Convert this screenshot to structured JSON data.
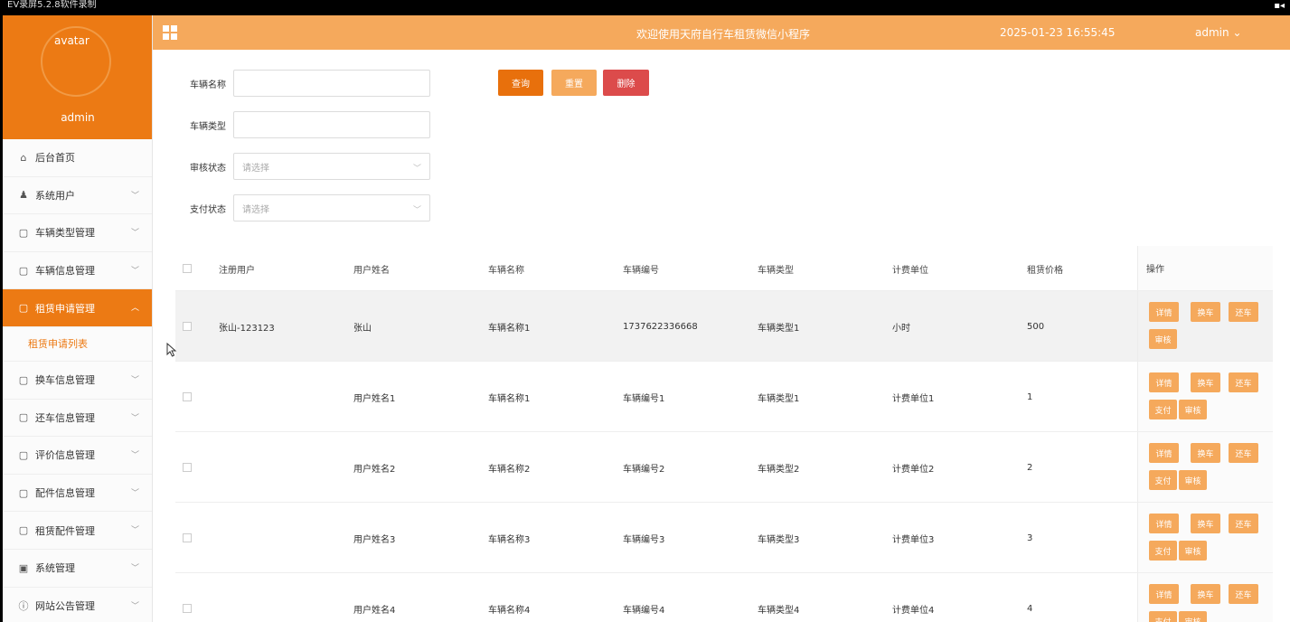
{
  "recorder": {
    "title": "EV录屏5.2.8软件录制"
  },
  "sidebar": {
    "avatar_text": "avatar",
    "username": "admin",
    "items": [
      {
        "label": "后台首页",
        "icon": "home-icon",
        "has_chevron": false
      },
      {
        "label": "系统用户",
        "icon": "user-icon",
        "has_chevron": true
      },
      {
        "label": "车辆类型管理",
        "icon": "doc-icon",
        "has_chevron": true
      },
      {
        "label": "车辆信息管理",
        "icon": "doc-icon",
        "has_chevron": true
      },
      {
        "label": "租赁申请管理",
        "icon": "doc-icon",
        "has_chevron": true,
        "active": true
      },
      {
        "label": "换车信息管理",
        "icon": "doc-icon",
        "has_chevron": true
      },
      {
        "label": "还车信息管理",
        "icon": "doc-icon",
        "has_chevron": true
      },
      {
        "label": "评价信息管理",
        "icon": "doc-icon",
        "has_chevron": true
      },
      {
        "label": "配件信息管理",
        "icon": "doc-icon",
        "has_chevron": true
      },
      {
        "label": "租赁配件管理",
        "icon": "doc-icon",
        "has_chevron": true
      },
      {
        "label": "系统管理",
        "icon": "image-icon",
        "has_chevron": true
      },
      {
        "label": "网站公告管理",
        "icon": "info-icon",
        "has_chevron": true
      }
    ],
    "submenu": {
      "label": "租赁申请列表"
    }
  },
  "header": {
    "title": "欢迎使用天府自行车租赁微信小程序",
    "datetime": "2025-01-23 16:55:45",
    "user": "admin"
  },
  "filters": {
    "vehicle_name_label": "车辆名称",
    "vehicle_type_label": "车辆类型",
    "audit_status_label": "审核状态",
    "audit_status_placeholder": "请选择",
    "pay_status_label": "支付状态",
    "pay_status_placeholder": "请选择"
  },
  "buttons": {
    "search": "查询",
    "reset": "重置",
    "delete": "删除"
  },
  "table": {
    "headers": [
      "注册用户",
      "用户姓名",
      "车辆名称",
      "车辆编号",
      "车辆类型",
      "计费单位",
      "租赁价格",
      "操作"
    ],
    "rows": [
      {
        "cells": [
          "张山-123123",
          "张山",
          "车辆名称1",
          "1737622336668",
          "车辆类型1",
          "小时",
          "500"
        ],
        "ops": [
          "详情",
          "换车",
          "还车",
          "审核"
        ]
      },
      {
        "cells": [
          "",
          "用户姓名1",
          "车辆名称1",
          "车辆编号1",
          "车辆类型1",
          "计费单位1",
          "1"
        ],
        "ops": [
          "详情",
          "换车",
          "还车",
          "支付",
          "审核"
        ]
      },
      {
        "cells": [
          "",
          "用户姓名2",
          "车辆名称2",
          "车辆编号2",
          "车辆类型2",
          "计费单位2",
          "2"
        ],
        "ops": [
          "详情",
          "换车",
          "还车",
          "支付",
          "审核"
        ]
      },
      {
        "cells": [
          "",
          "用户姓名3",
          "车辆名称3",
          "车辆编号3",
          "车辆类型3",
          "计费单位3",
          "3"
        ],
        "ops": [
          "详情",
          "换车",
          "还车",
          "支付",
          "审核"
        ]
      },
      {
        "cells": [
          "",
          "用户姓名4",
          "车辆名称4",
          "车辆编号4",
          "车辆类型4",
          "计费单位4",
          "4"
        ],
        "ops": [
          "详情",
          "换车",
          "还车",
          "支付",
          "审核"
        ]
      }
    ]
  },
  "colors": {
    "primary": "#ec7a14",
    "light": "#f5a95c",
    "danger": "#dc4b4b"
  }
}
